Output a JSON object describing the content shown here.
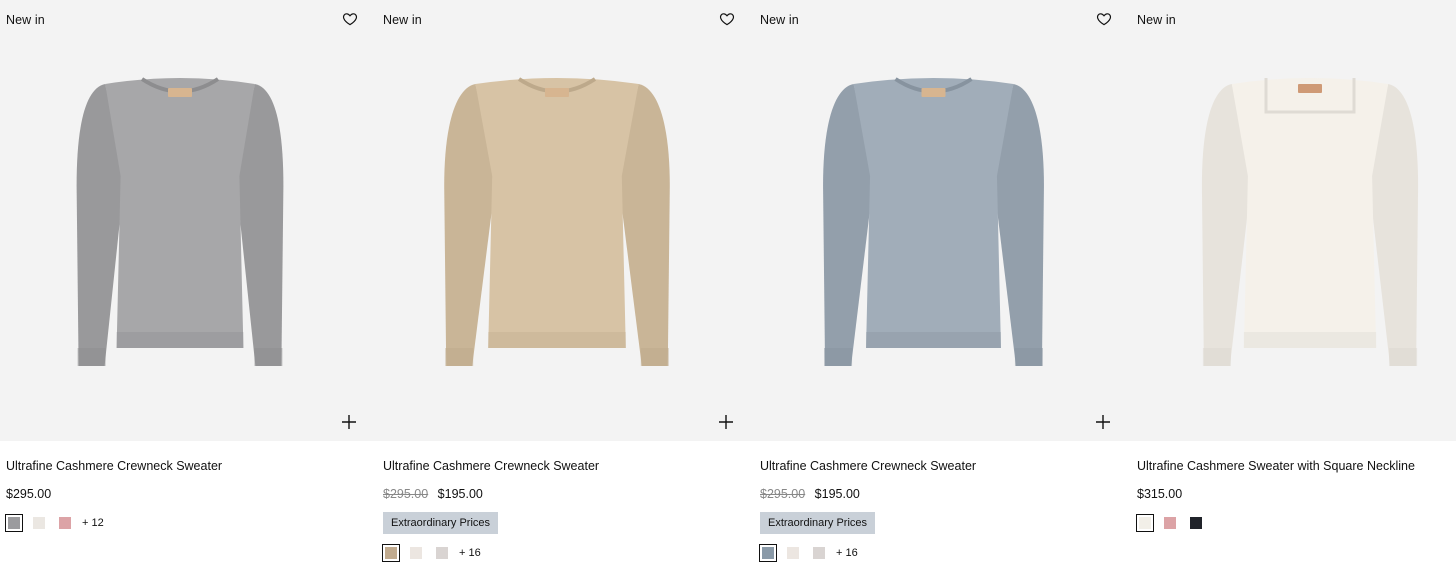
{
  "products": [
    {
      "badge": "New in",
      "title": "Ultrafine Cashmere Crewneck Sweater",
      "price_old": "",
      "price": "$295.00",
      "promo": "",
      "garment_color": "#a7a7a9",
      "swatches": [
        "#9b9b9e",
        "#ebe7e2",
        "#dca3a6"
      ],
      "more": "+ 12"
    },
    {
      "badge": "New in",
      "title": "Ultrafine Cashmere Crewneck Sweater",
      "price_old": "$295.00",
      "price": "$195.00",
      "promo": "Extraordinary Prices",
      "garment_color": "#d7c3a5",
      "swatches": [
        "#c1ab8f",
        "#ece6e1",
        "#d9d4d2"
      ],
      "more": "+ 16"
    },
    {
      "badge": "New in",
      "title": "Ultrafine Cashmere Crewneck Sweater",
      "price_old": "$295.00",
      "price": "$195.00",
      "promo": "Extraordinary Prices",
      "garment_color": "#a1adb9",
      "swatches": [
        "#8a9aa8",
        "#ece6e1",
        "#d9d4d2"
      ],
      "more": "+ 16"
    },
    {
      "badge": "New in",
      "title": "Ultrafine Cashmere Sweater with Square Neckline",
      "price_old": "",
      "price": "$315.00",
      "promo": "",
      "garment_color": "#f5f1ea",
      "swatches": [
        "#f2efe8",
        "#dca3a6",
        "#20232a"
      ],
      "more": ""
    }
  ],
  "icons": {
    "wishlist": "heart-icon",
    "quick_add": "plus-icon"
  }
}
